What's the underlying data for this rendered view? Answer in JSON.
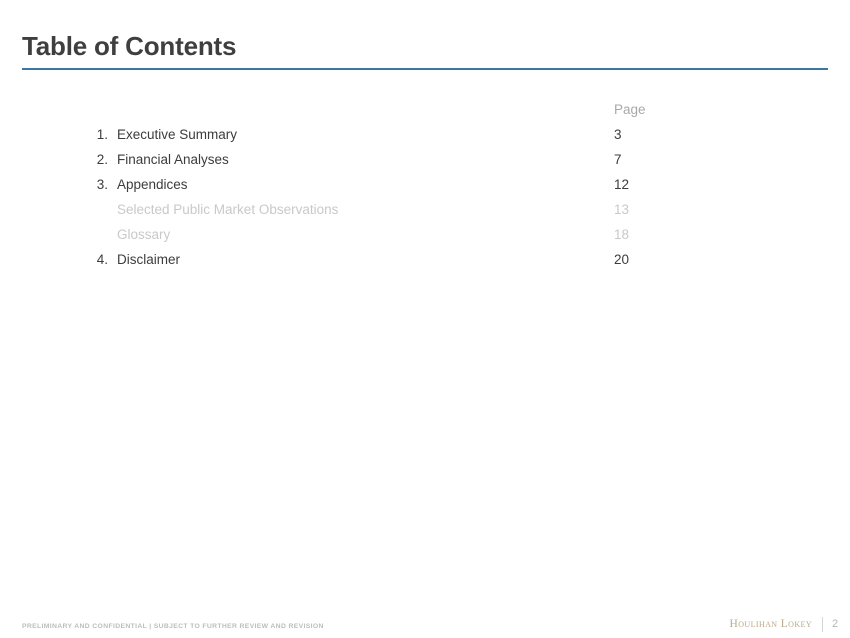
{
  "slide": {
    "title": "Table of Contents"
  },
  "toc": {
    "page_header": "Page",
    "rows": [
      {
        "num": "1.",
        "label": "Executive Summary",
        "page": "3",
        "sub": false
      },
      {
        "num": "2.",
        "label": "Financial Analyses",
        "page": "7",
        "sub": false
      },
      {
        "num": "3.",
        "label": "Appendices",
        "page": "12",
        "sub": false
      },
      {
        "num": "",
        "label": "Selected Public Market Observations",
        "page": "13",
        "sub": true
      },
      {
        "num": "",
        "label": "Glossary",
        "page": "18",
        "sub": true
      },
      {
        "num": "4.",
        "label": "Disclaimer",
        "page": "20",
        "sub": false
      }
    ]
  },
  "footer": {
    "confidentiality": "PRELIMINARY AND CONFIDENTIAL | SUBJECT TO FURTHER REVIEW AND REVISION",
    "logo_text": "Houlihan Lokey",
    "page_number": "2"
  },
  "colors": {
    "accent_rule": "#3a77a3",
    "title": "#3f3f3f",
    "body_text": "#3c3c3c",
    "muted_text": "#c9c9c9",
    "header_text": "#a9a9a9",
    "logo_gold": "#b9aa8a",
    "footer_gray": "#bdbdbd"
  }
}
